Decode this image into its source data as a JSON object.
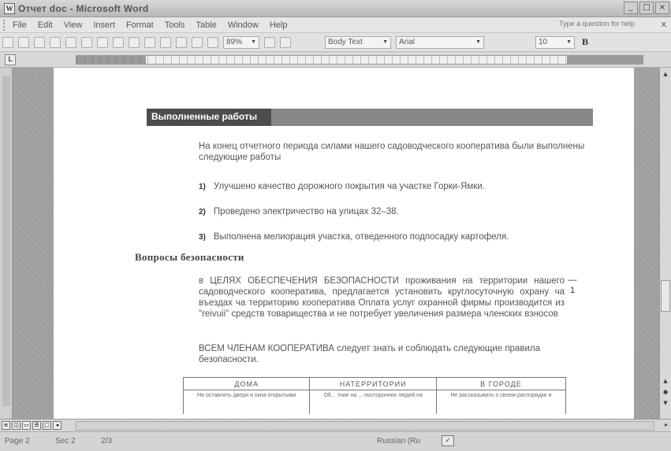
{
  "window": {
    "title": "Отчет doc - Microsoft Word",
    "icon": "word-doc-icon"
  },
  "menu": {
    "items": [
      "File",
      "Edit",
      "View",
      "Insert",
      "Format",
      "Tools",
      "Table",
      "Window",
      "Help"
    ],
    "help_placeholder": "Type a question for help",
    "close_label": "x"
  },
  "toolbar": {
    "zoom": "89%",
    "style": "Body Text",
    "font": "Arial",
    "size": "10",
    "bold_label": "B"
  },
  "document": {
    "heading": "Выполненные работы",
    "intro": "На конец отчетного периода силами нашего садоводческого кооператива были выполнены следующие работы",
    "list": [
      {
        "num": "1)",
        "text": "Улучшено качество дорожного покрытия ча участке Горки-Ямки."
      },
      {
        "num": "2)",
        "text": "Проведено электричество на улицах 32–38."
      },
      {
        "num": "3)",
        "text": "Выполнена мелиорация участка, отведенного подпосадку картофеля."
      }
    ],
    "section2": "Вопросы безопасности",
    "body1": "в ЦЕЛЯХ ОБЕСПЕЧЕНИЯ БЕЗОПАСНОСТИ проживания на территории нашего садоводческого кооператива, предлагается установить круглосуточную охрану ча въездах ча территорию кооператива Оплата услуг охранной фирмы производится из \"reivuii\" средств товарищества и не потребует увеличения размера членских взносов",
    "margin_note": "— 1",
    "body2": "ВСЕМ ЧЛЕНАМ КООПЕРАТИВА следует знать и соблюдать следующие правила безопасности.",
    "table": {
      "headers": [
        "ДОМА",
        "НАТЕРРИТОРИИ",
        "В ГОРОДЕ"
      ],
      "cells": [
        "Не оставлять двери и окна открытыми",
        "Об... тние на ... посторонних людей на",
        "Не рассказывать о своем распорядке и"
      ]
    }
  },
  "status": {
    "page": "Page 2",
    "sec": "Sec 2",
    "pos": "2/3",
    "language": "Russian (Ru"
  }
}
